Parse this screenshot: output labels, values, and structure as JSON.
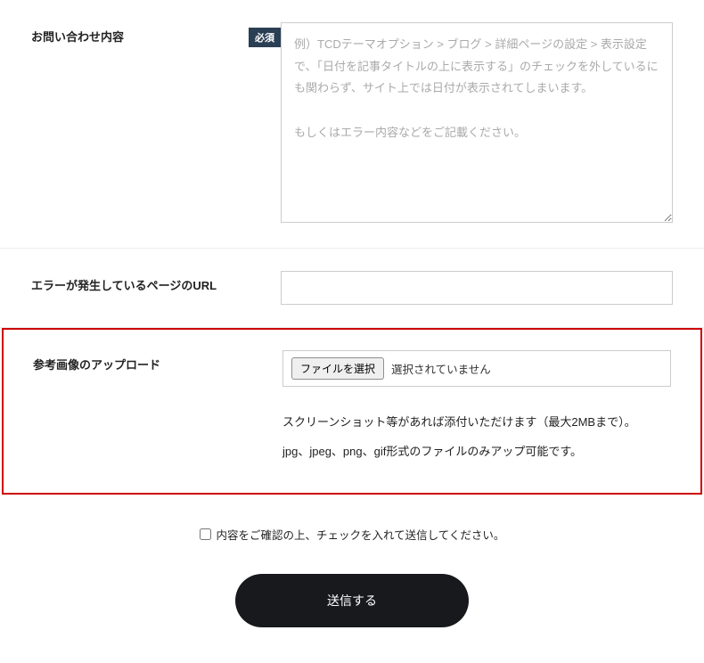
{
  "inquiry": {
    "label": "お問い合わせ内容",
    "required_badge": "必須",
    "placeholder": "例）TCDテーマオプション > ブログ > 詳細ページの設定 > 表示設定で、「日付を記事タイトルの上に表示する」のチェックを外しているにも関わらず、サイト上では日付が表示されてしまいます。\n\nもしくはエラー内容などをご記載ください。"
  },
  "error_url": {
    "label": "エラーが発生しているページのURL"
  },
  "upload": {
    "label": "参考画像のアップロード",
    "file_button": "ファイルを選択",
    "file_status": "選択されていません",
    "hint_line1": "スクリーンショット等があれば添付いただけます（最大2MBまで）。",
    "hint_line2": "jpg、jpeg、png、gif形式のファイルのみアップ可能です。"
  },
  "confirm": {
    "label": "内容をご確認の上、チェックを入れて送信してください。"
  },
  "submit": {
    "label": "送信する"
  }
}
